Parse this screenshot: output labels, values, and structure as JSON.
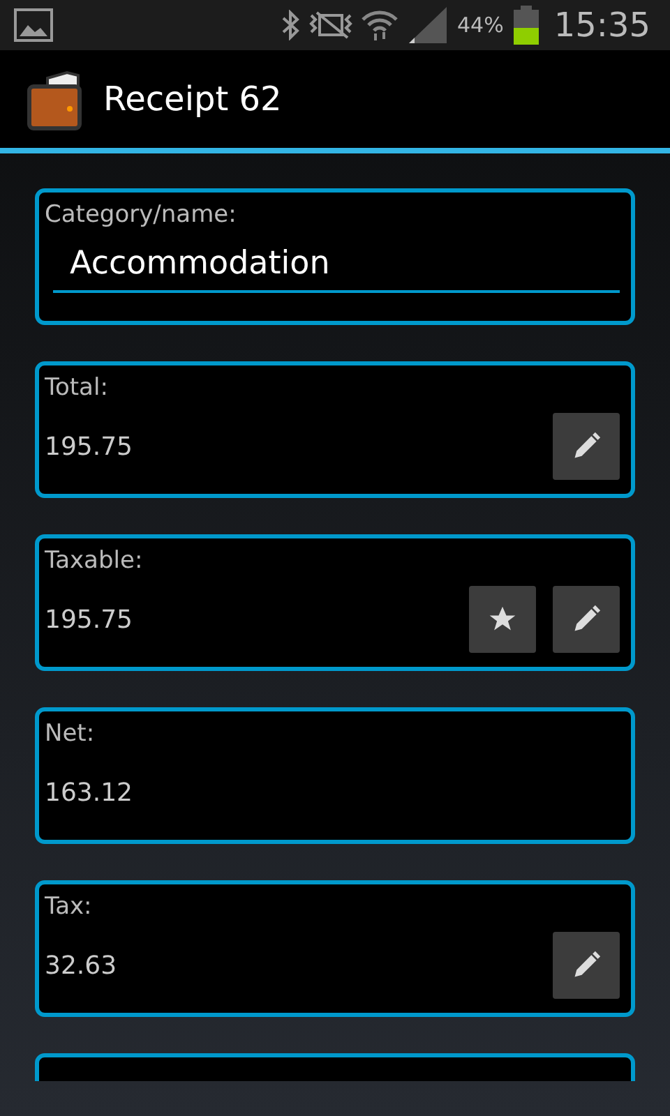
{
  "status_bar": {
    "battery_percent": "44%",
    "time": "15:35"
  },
  "action_bar": {
    "title": "Receipt 62"
  },
  "name_field": {
    "label": "Category/name:",
    "value": "Accommodation"
  },
  "fields": [
    {
      "label": "Total:",
      "value": "195.75",
      "buttons": [
        {
          "kind": "edit"
        }
      ]
    },
    {
      "label": "Taxable:",
      "value": "195.75",
      "buttons": [
        {
          "kind": "star"
        },
        {
          "kind": "edit"
        }
      ]
    },
    {
      "label": "Net:",
      "value": "163.12"
    },
    {
      "label": "Tax:",
      "value": "32.63",
      "buttons": [
        {
          "kind": "edit"
        }
      ]
    }
  ]
}
